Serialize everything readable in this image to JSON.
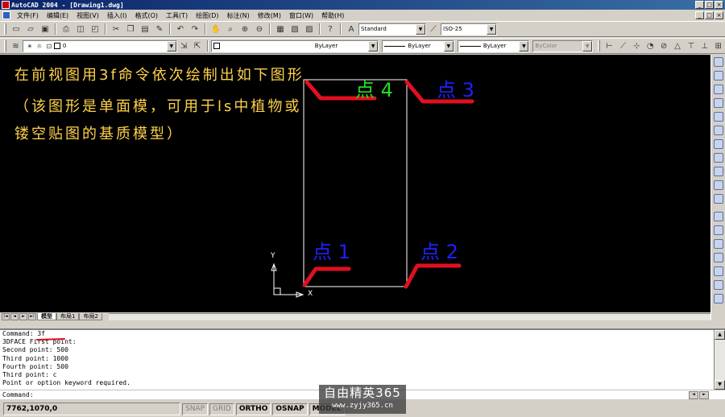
{
  "window": {
    "title": "AutoCAD 2004 - [Drawing1.dwg]",
    "buttons": [
      "_",
      "□",
      "×"
    ],
    "mdi_buttons": [
      "_",
      "□",
      "×"
    ]
  },
  "menu": [
    "文件(F)",
    "编辑(E)",
    "视图(V)",
    "插入(I)",
    "格式(O)",
    "工具(T)",
    "绘图(D)",
    "标注(N)",
    "修改(M)",
    "窗口(W)",
    "帮助(H)"
  ],
  "toolbar": {
    "text_style": "Standard",
    "dim_style": "ISO-25"
  },
  "properties": {
    "layer": "0",
    "color": "ByLayer",
    "linetype": "ByLayer",
    "lineweight": "ByLayer",
    "plot_style": "ByColor"
  },
  "instructions": [
    "在前视图用3f命令依次绘制出如下图形",
    "（该图形是单面模，可用于ls中植物或",
    "镂空贴图的基质模型）"
  ],
  "points": {
    "p1": "点 1",
    "p2": "点 2",
    "p3": "点 3",
    "p4": "点 4"
  },
  "ucs": {
    "x": "X",
    "y": "Y"
  },
  "tabs": [
    "模型",
    "布局1",
    "布局2"
  ],
  "tab_nav": [
    "|◄",
    "◄",
    "►",
    "►|"
  ],
  "scroll": {
    "up": "▲",
    "down": "▼",
    "left": "◄",
    "right": "►"
  },
  "command_history": [
    "Command: 3f",
    "3DFACE First point:",
    "Second point: 500",
    "Third point: 1000",
    "Fourth point: 500",
    "Third point: c",
    "Point or option keyword required."
  ],
  "command_prompt": "Command:",
  "status": {
    "coords": "7762,1070,0",
    "snap": "SNAP",
    "grid": "GRID",
    "ortho": "ORTHO",
    "osnap": "OSNAP",
    "model": "MODEL"
  },
  "watermark": {
    "name": "自由精英365",
    "url": "www.zyjy365.cn"
  },
  "colors": {
    "instruction_text": "#ffd24a",
    "point_1_2_3": "#2020ff",
    "point_4": "#22dd22",
    "annotation_stroke": "#e01020",
    "drawing_background": "#000000"
  }
}
